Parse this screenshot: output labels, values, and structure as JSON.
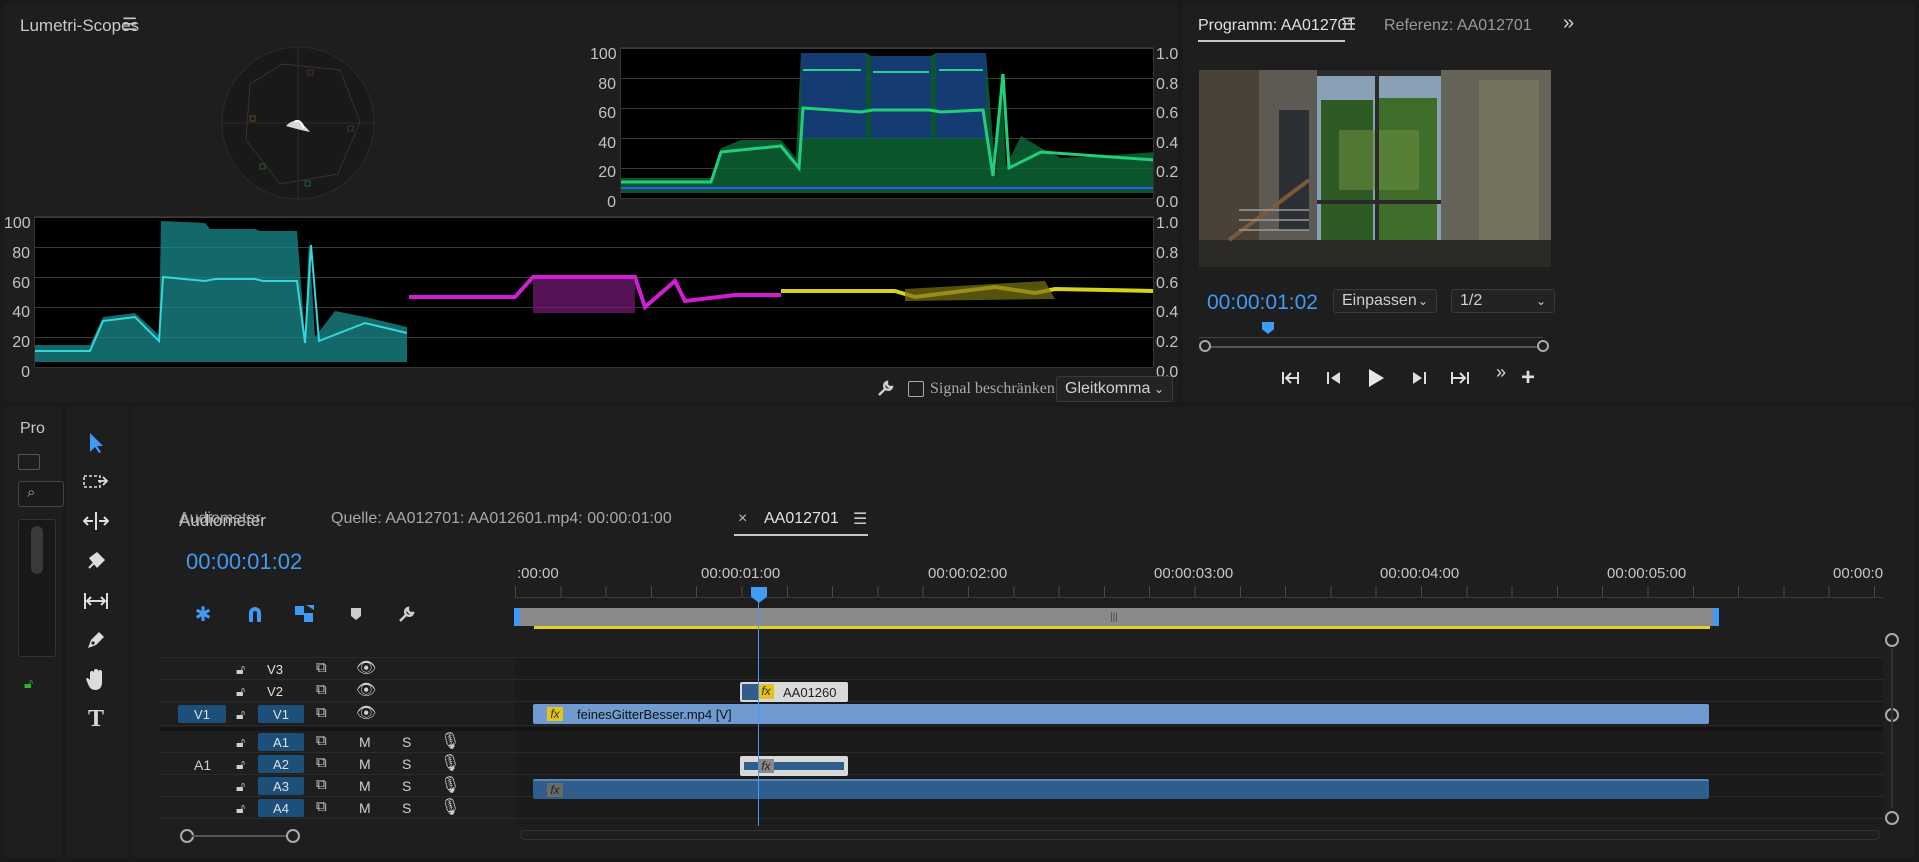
{
  "lumetri": {
    "title": "Lumetri-Scopes"
  },
  "scopes": {
    "left_axis": [
      "100",
      "80",
      "60",
      "40",
      "20",
      "0"
    ],
    "right_axis": [
      "1.0",
      "0.8",
      "0.6",
      "0.4",
      "0.2",
      "0.0"
    ]
  },
  "scope_footer": {
    "signal_label": "Signal beschränken",
    "mode_value": "Gleitkomma"
  },
  "program": {
    "tab_program": "Programm: AA012701",
    "tab_reference": "Referenz: AA012701",
    "timecode": "00:00:01:02",
    "fit_value": "Einpassen",
    "resolution_value": "1/2"
  },
  "project": {
    "title": "Pro"
  },
  "timeline": {
    "tab_audiometer": "Audiometer",
    "tab_source": "Quelle: AA012701: AA012601.mp4: 00:00:01:00",
    "tab_sequence": "AA012701",
    "close_x": "×",
    "timecode": "00:00:01:02",
    "ruler": [
      ":00:00",
      "00:00:01:00",
      "00:00:02:00",
      "00:00:03:00",
      "00:00:04:00",
      "00:00:05:00",
      "00:00:0"
    ],
    "video_tracks": [
      {
        "source": "",
        "name": "V3"
      },
      {
        "source": "",
        "name": "V2"
      },
      {
        "source": "V1",
        "name": "V1"
      }
    ],
    "audio_tracks": [
      {
        "source": "",
        "name": "A1"
      },
      {
        "source": "A1",
        "name": "A2"
      },
      {
        "source": "",
        "name": "A3"
      },
      {
        "source": "",
        "name": "A4"
      }
    ],
    "mute": "M",
    "solo": "S",
    "clip_v2": "AA01260",
    "clip_v1": "feinesGitterBesser.mp4 [V]",
    "fx": "fx"
  },
  "colors": {
    "accent": "#3f9bf5",
    "clip_video": "#6f9bd1",
    "clip_audio": "#2f5d8c",
    "yellow": "#e6d21e"
  }
}
